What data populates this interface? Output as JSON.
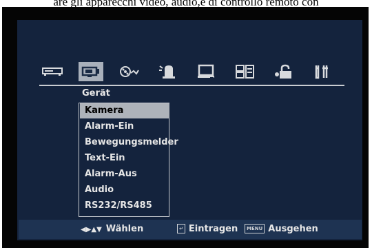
{
  "caption": "are gli apparecchi video, audio,e di controllo remoto con",
  "icons": [
    {
      "name": "recorder-icon",
      "selected": false
    },
    {
      "name": "camera-icon",
      "selected": true
    },
    {
      "name": "record-reels-icon",
      "selected": false
    },
    {
      "name": "alarm-icon",
      "selected": false
    },
    {
      "name": "monitor-icon",
      "selected": false
    },
    {
      "name": "network-icon",
      "selected": false
    },
    {
      "name": "lock-icon",
      "selected": false
    },
    {
      "name": "tools-icon",
      "selected": false
    }
  ],
  "menu": {
    "title": "Gerät",
    "items": [
      {
        "label": "Kamera",
        "selected": true
      },
      {
        "label": "Alarm-Ein",
        "selected": false
      },
      {
        "label": "Bewegungsmelder",
        "selected": false
      },
      {
        "label": "Text-Ein",
        "selected": false
      },
      {
        "label": "Alarm-Aus",
        "selected": false
      },
      {
        "label": "Audio",
        "selected": false
      },
      {
        "label": "RS232/RS485",
        "selected": false
      }
    ]
  },
  "status": {
    "arrows": "◀▶▲▼",
    "select_label": "Wählen",
    "enter_label": "Eintragen",
    "menu_key": "MENU",
    "exit_label": "Ausgehen"
  },
  "colors": {
    "screen_bg": "#14233d",
    "status_bg": "#1e3352",
    "highlight": "#aeb3ba",
    "text": "#e6e6e6"
  }
}
